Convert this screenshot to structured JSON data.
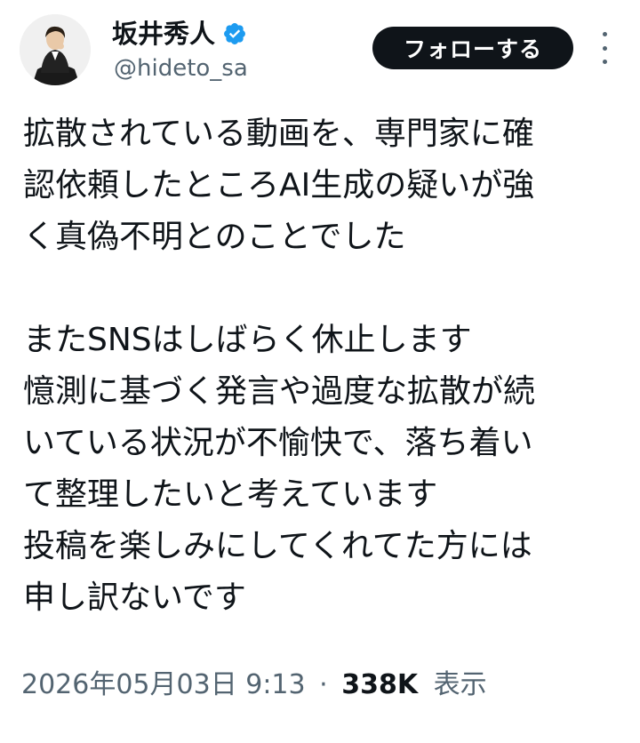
{
  "author": {
    "display_name": "坂井秀人",
    "handle": "@hideto_sa",
    "verified": true
  },
  "actions": {
    "follow_label": "フォローする",
    "more_icon": "more-vertical-icon"
  },
  "post": {
    "lines": [
      "拡散されている動画を、専門家に確",
      "認依頼したところAI生成の疑いが強",
      "く真偽不明とのことでした",
      "",
      "またSNSはしばらく休止します",
      "憶測に基づく発言や過度な拡散が続",
      "いている状況が不愉快で、落ち着い",
      "て整理したいと考えています",
      "投稿を楽しみにしてくれてた方には",
      "申し訳ないです"
    ]
  },
  "meta": {
    "timestamp": "2026年05月03日 9:13",
    "separator": "·",
    "views_count": "338K",
    "views_label": "表示"
  },
  "colors": {
    "text_primary": "#0f1419",
    "text_secondary": "#536471",
    "verified_blue": "#1d9bf0",
    "button_bg": "#0f1419"
  }
}
